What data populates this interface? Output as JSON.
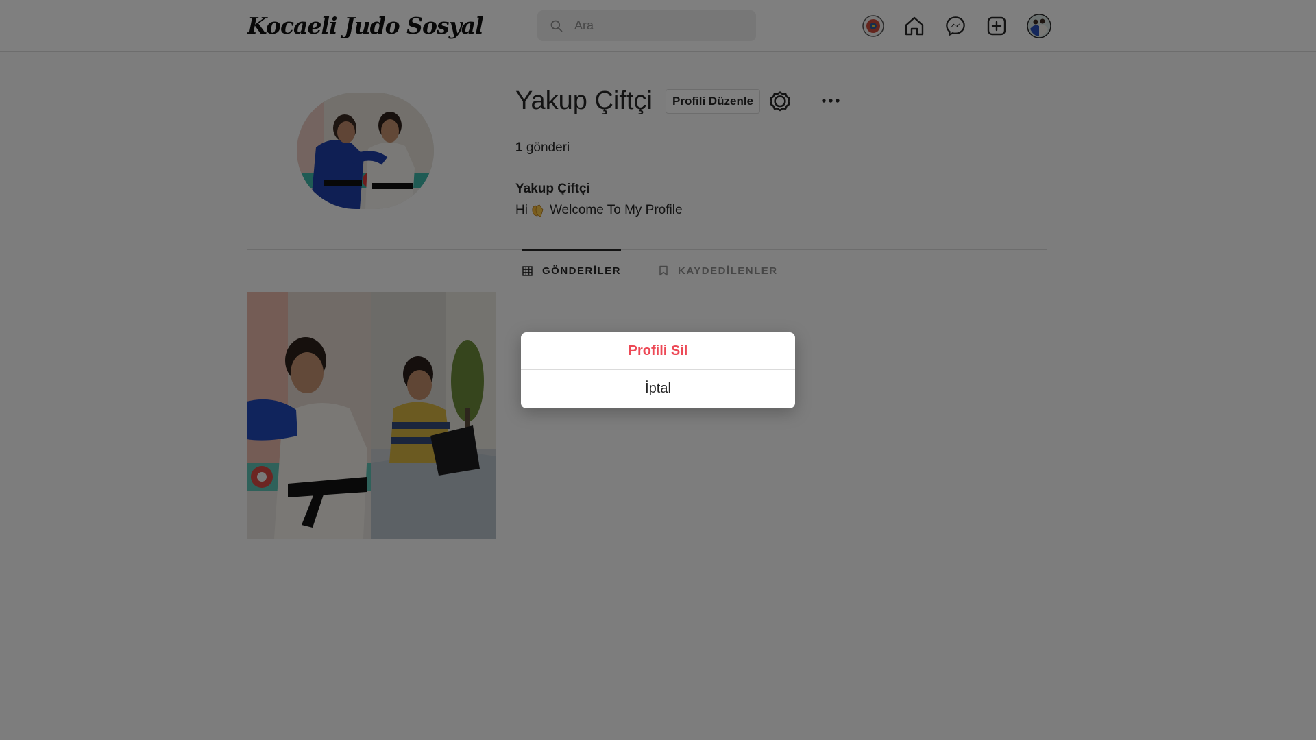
{
  "header": {
    "logo": "Kocaeli Judo Sosyal",
    "search_placeholder": "Ara",
    "icons": [
      "judo-logo-icon",
      "home-icon",
      "messenger-icon",
      "new-post-icon",
      "profile-avatar-icon"
    ]
  },
  "profile": {
    "username": "Yakup Çiftçi",
    "edit_label": "Profili Düzenle",
    "post_count": "1",
    "post_label": "gönderi",
    "full_name": "Yakup Çiftçi",
    "bio_prefix": "Hi",
    "bio_suffix": "Welcome To My Profile"
  },
  "tabs": [
    {
      "label": "GÖNDERİLER",
      "icon": "grid-icon",
      "active": true
    },
    {
      "label": "KAYDEDİLENLER",
      "icon": "bookmark-icon",
      "active": false
    }
  ],
  "modal": {
    "delete_label": "Profili Sil",
    "cancel_label": "İptal"
  },
  "colors": {
    "danger": "#ed4956",
    "text": "#262626",
    "muted": "#8e8e8e",
    "border": "#dbdbdb"
  }
}
